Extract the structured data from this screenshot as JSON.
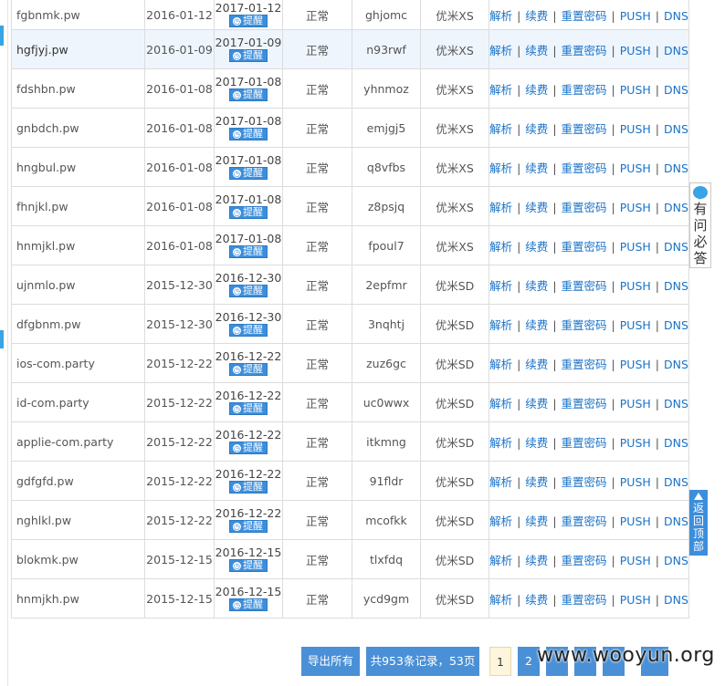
{
  "rows": [
    {
      "domain": "fgbnmk.pw",
      "reg": "2016-01-12",
      "expire": "2017-01-12",
      "status": "正常",
      "pwd": "ghjomc",
      "plan": "优米XS"
    },
    {
      "domain": "hgfjyj.pw",
      "reg": "2016-01-09",
      "expire": "2017-01-09",
      "status": "正常",
      "pwd": "n93rwf",
      "plan": "优米XS"
    },
    {
      "domain": "fdshbn.pw",
      "reg": "2016-01-08",
      "expire": "2017-01-08",
      "status": "正常",
      "pwd": "yhnmoz",
      "plan": "优米XS"
    },
    {
      "domain": "gnbdch.pw",
      "reg": "2016-01-08",
      "expire": "2017-01-08",
      "status": "正常",
      "pwd": "emjgj5",
      "plan": "优米XS"
    },
    {
      "domain": "hngbul.pw",
      "reg": "2016-01-08",
      "expire": "2017-01-08",
      "status": "正常",
      "pwd": "q8vfbs",
      "plan": "优米XS"
    },
    {
      "domain": "fhnjkl.pw",
      "reg": "2016-01-08",
      "expire": "2017-01-08",
      "status": "正常",
      "pwd": "z8psjq",
      "plan": "优米XS"
    },
    {
      "domain": "hnmjkl.pw",
      "reg": "2016-01-08",
      "expire": "2017-01-08",
      "status": "正常",
      "pwd": "fpoul7",
      "plan": "优米XS"
    },
    {
      "domain": "ujnmlo.pw",
      "reg": "2015-12-30",
      "expire": "2016-12-30",
      "status": "正常",
      "pwd": "2epfmr",
      "plan": "优米SD"
    },
    {
      "domain": "dfgbnm.pw",
      "reg": "2015-12-30",
      "expire": "2016-12-30",
      "status": "正常",
      "pwd": "3nqhtj",
      "plan": "优米SD"
    },
    {
      "domain": "ios-com.party",
      "reg": "2015-12-22",
      "expire": "2016-12-22",
      "status": "正常",
      "pwd": "zuz6gc",
      "plan": "优米SD"
    },
    {
      "domain": "id-com.party",
      "reg": "2015-12-22",
      "expire": "2016-12-22",
      "status": "正常",
      "pwd": "uc0wwx",
      "plan": "优米SD"
    },
    {
      "domain": "applie-com.party",
      "reg": "2015-12-22",
      "expire": "2016-12-22",
      "status": "正常",
      "pwd": "itkmng",
      "plan": "优米SD"
    },
    {
      "domain": "gdfgfd.pw",
      "reg": "2015-12-22",
      "expire": "2016-12-22",
      "status": "正常",
      "pwd": "91fldr",
      "plan": "优米SD"
    },
    {
      "domain": "nghlkl.pw",
      "reg": "2015-12-22",
      "expire": "2016-12-22",
      "status": "正常",
      "pwd": "mcofkk",
      "plan": "优米SD"
    },
    {
      "domain": "blokmk.pw",
      "reg": "2015-12-15",
      "expire": "2016-12-15",
      "status": "正常",
      "pwd": "tlxfdq",
      "plan": "优米SD"
    },
    {
      "domain": "hnmjkh.pw",
      "reg": "2015-12-15",
      "expire": "2016-12-15",
      "status": "正常",
      "pwd": "ycd9gm",
      "plan": "优米SD"
    }
  ],
  "highlighted_row": 1,
  "remind_label": "提醒",
  "remind_icon": "clock-icon",
  "actions": [
    "解析",
    "续费",
    "重置密码",
    "PUSH",
    "DNS"
  ],
  "side_help": {
    "text": "有问必答",
    "icon": "chat-bubble-icon"
  },
  "side_top": {
    "text": "返回顶部",
    "icon": "up-arrow-icon"
  },
  "pager": {
    "export_label": "导出所有",
    "summary": "共953条记录，53页",
    "current_page": "1",
    "next_page": "2",
    "more_pages": [
      "",
      "",
      "",
      ""
    ]
  },
  "watermark": "www.wooyun.org",
  "colors": {
    "accent": "#3c8edc",
    "link": "#1a73c8",
    "row_highlight": "#eef5fd"
  }
}
